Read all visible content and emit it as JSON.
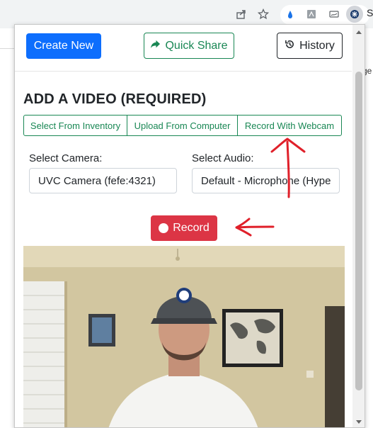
{
  "toolbar": {
    "icons": [
      "share-icon",
      "star-icon",
      "water-drop-extension-icon",
      "pdf-extension-icon",
      "sign-extension-icon",
      "active-extension-icon"
    ],
    "cut_text": "S"
  },
  "page_behind": {
    "cut_text": "ge"
  },
  "header": {
    "create_label": "Create New",
    "share_label": "Quick Share",
    "history_label": "History"
  },
  "section": {
    "title": "ADD A VIDEO (REQUIRED)"
  },
  "tabs": [
    {
      "label": "Select From Inventory"
    },
    {
      "label": "Upload From Computer"
    },
    {
      "label": "Record With Webcam"
    }
  ],
  "camera": {
    "label": "Select Camera:",
    "value": "UVC Camera (fefe:4321)"
  },
  "audio": {
    "label": "Select Audio:",
    "value": "Default - Microphone (Hype"
  },
  "record": {
    "label": "Record"
  },
  "colors": {
    "primary": "#0d6efd",
    "success": "#198754",
    "danger": "#dc3545",
    "annotation": "#e0202a"
  }
}
